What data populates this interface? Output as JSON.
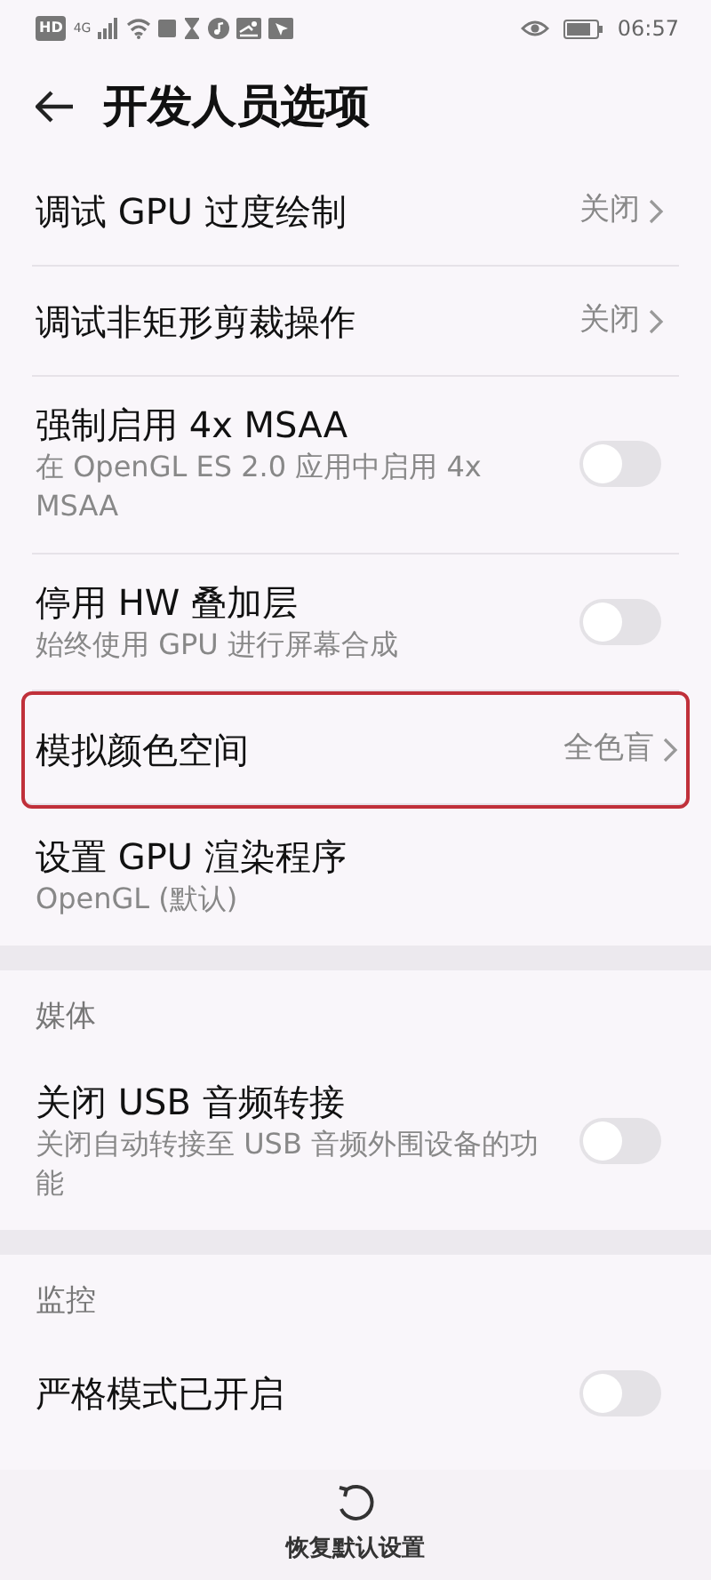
{
  "status_bar": {
    "left_badge": "HD",
    "network": "4G",
    "time": "06:57"
  },
  "title": "开发人员选项",
  "sections": [
    {
      "items": [
        {
          "kind": "link",
          "title": "调试 GPU 过度绘制",
          "value": "关闭",
          "highlighted": false
        },
        {
          "kind": "link",
          "title": "调试非矩形剪裁操作",
          "value": "关闭",
          "highlighted": false
        },
        {
          "kind": "toggle",
          "title": "强制启用 4x MSAA",
          "subtitle": "在 OpenGL ES 2.0 应用中启用 4x MSAA",
          "on": false
        },
        {
          "kind": "toggle",
          "title": "停用 HW 叠加层",
          "subtitle": "始终使用 GPU 进行屏幕合成",
          "on": false
        },
        {
          "kind": "link",
          "title": "模拟颜色空间",
          "value": "全色盲",
          "highlighted": true
        },
        {
          "kind": "info",
          "title": "设置 GPU 渲染程序",
          "subtitle": "OpenGL (默认)"
        }
      ]
    },
    {
      "header": "媒体",
      "items": [
        {
          "kind": "toggle",
          "title": "关闭 USB 音频转接",
          "subtitle": "关闭自动转接至 USB 音频外围设备的功能",
          "on": false
        }
      ]
    },
    {
      "header": "监控",
      "items": [
        {
          "kind": "toggle",
          "title": "严格模式已开启",
          "on": false
        }
      ]
    }
  ],
  "bottom_button": "恢复默认设置"
}
